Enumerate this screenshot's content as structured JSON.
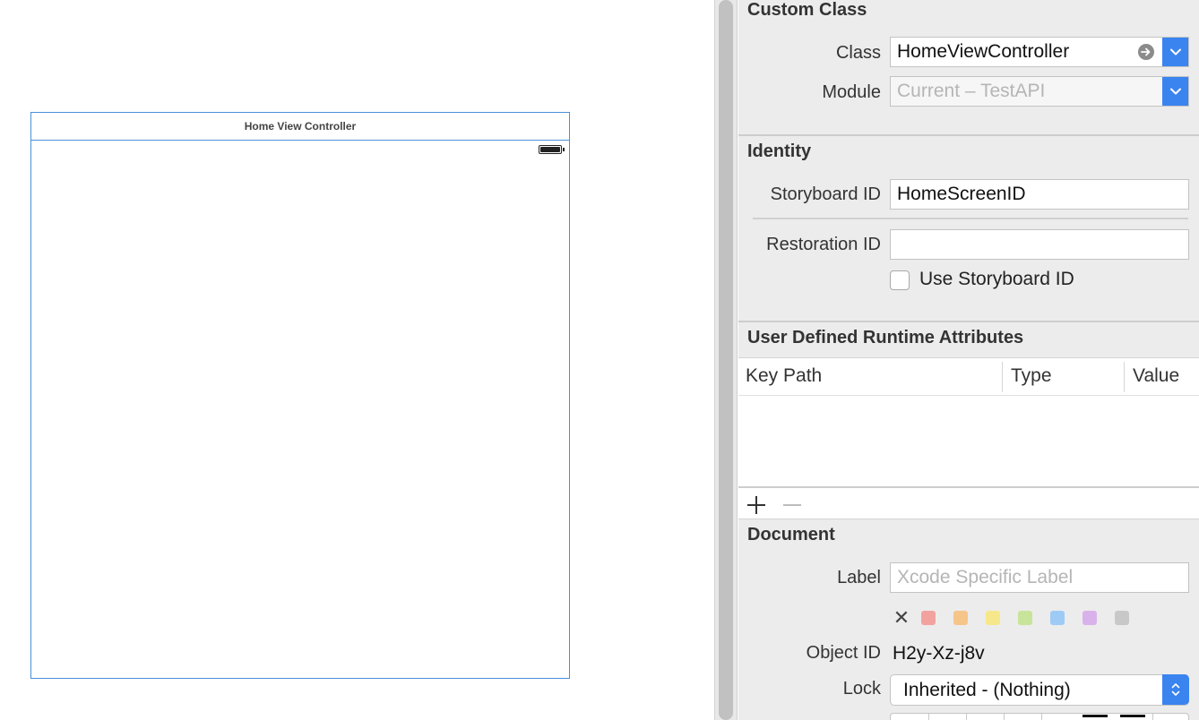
{
  "canvas": {
    "scene_title": "Home View Controller"
  },
  "inspector": {
    "custom_class": {
      "title": "Custom Class",
      "class_label": "Class",
      "class_value": "HomeViewController",
      "module_label": "Module",
      "module_placeholder": "Current – TestAPI"
    },
    "identity": {
      "title": "Identity",
      "storyboard_id_label": "Storyboard ID",
      "storyboard_id_value": "HomeScreenID",
      "restoration_id_label": "Restoration ID",
      "restoration_id_value": "",
      "use_storyboard_id_label": "Use Storyboard ID",
      "use_storyboard_id_checked": false
    },
    "runtime_attributes": {
      "title": "User Defined Runtime Attributes",
      "columns": [
        "Key Path",
        "Type",
        "Value"
      ],
      "rows": []
    },
    "document": {
      "title": "Document",
      "label_label": "Label",
      "label_placeholder": "Xcode Specific Label",
      "swatch_colors": [
        "#f2a3a0",
        "#f6c58a",
        "#f6e88a",
        "#c8e49a",
        "#9ecbf6",
        "#d9b2ec",
        "#c8c8c8"
      ],
      "object_id_label": "Object ID",
      "object_id_value": "H2y-Xz-j8v",
      "lock_label": "Lock",
      "lock_value": "Inherited - (Nothing)"
    }
  }
}
